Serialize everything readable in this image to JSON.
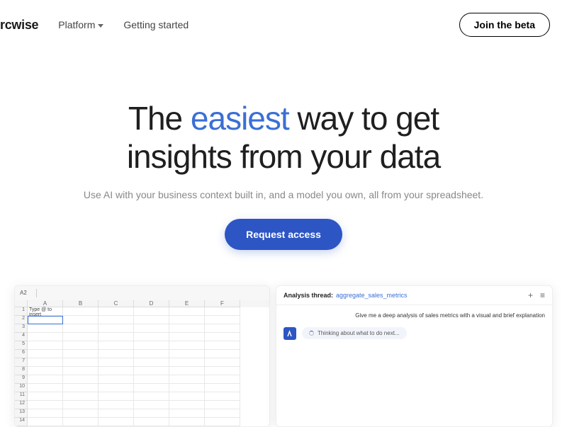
{
  "nav": {
    "logo": "rcwise",
    "items": [
      "Platform",
      "Getting started"
    ],
    "beta_label": "Join the beta"
  },
  "hero": {
    "title_pre": "The ",
    "title_highlight": "easiest",
    "title_mid": " way to get",
    "title_line2": "insights from your data",
    "subtitle": "Use AI with your business context built in, and a model you own, all from your spreadsheet.",
    "cta": "Request access"
  },
  "spreadsheet": {
    "cell_ref": "A2",
    "columns": [
      "A",
      "B",
      "C",
      "D",
      "E",
      "F"
    ],
    "row_numbers": [
      1,
      2,
      3,
      4,
      5,
      6,
      7,
      8,
      9,
      10,
      11,
      12,
      13,
      14
    ],
    "a1_value": "Type @ to insert",
    "selected_cell": "A2"
  },
  "chat": {
    "header_label": "Analysis thread:",
    "thread_name": "aggregate_sales_metrics",
    "user_message": "Give me a deep analysis of sales metrics with a visual and brief explanation",
    "thinking_label": "Thinking about what to do next...",
    "icons": {
      "plus": "+",
      "menu": "≡"
    },
    "avatar_letter": "A"
  }
}
